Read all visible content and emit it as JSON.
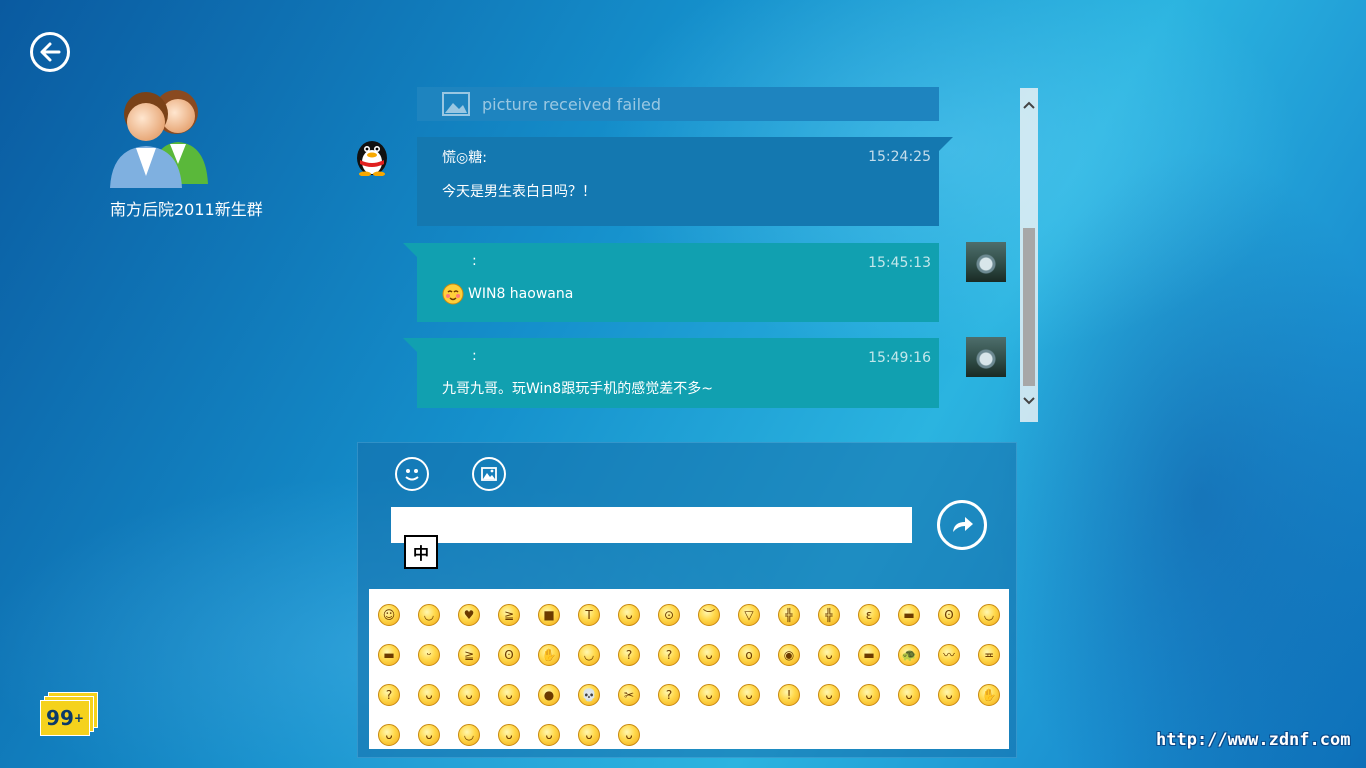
{
  "group": {
    "name": "南方后院2011新生群"
  },
  "messages": {
    "failed": {
      "text": "picture received failed"
    },
    "m1": {
      "sender": "慌◎糖:",
      "time": "15:24:25",
      "text": "今天是男生表白日吗？！"
    },
    "m2": {
      "sender": ":",
      "time": "15:45:13",
      "text": "WIN8 haowana",
      "emoji": "blush-emoji"
    },
    "m3": {
      "sender": ":",
      "time": "15:49:16",
      "text": "九哥九哥。玩Win8跟玩手机的感觉差不多~"
    }
  },
  "compose": {
    "input_value": "",
    "ime_label": "中",
    "tools": [
      "emoji-picker-icon",
      "image-picker-icon"
    ]
  },
  "emoji_rows": [
    [
      "☺",
      "◡",
      "♥",
      "≧",
      "■",
      "T",
      "ᴗ",
      "⊙",
      "︶",
      "▽",
      "╬",
      "╬",
      "ε",
      "▬",
      "ʘ",
      "◡"
    ],
    [
      "▬",
      "ᵕ",
      "≧",
      "ʘ",
      "✋",
      "◡",
      "?",
      "?",
      "ᴗ",
      "o",
      "◉",
      "ᴗ",
      "▬",
      "🐢",
      "〰",
      "≖"
    ],
    [
      "?",
      "ᴗ",
      "ᴗ",
      "ᴗ",
      "●",
      "💀",
      "✂",
      "?",
      "ᴗ",
      "ᴗ",
      "!",
      "ᴗ",
      "ᴗ",
      "ᴗ",
      "ᴗ",
      "✋"
    ],
    [
      "ᴗ",
      "ᴗ",
      "◡",
      "ᴗ",
      "ᴗ",
      "ᴗ",
      "ᴗ"
    ]
  ],
  "badge": {
    "count": "99",
    "suffix": "+"
  },
  "watermark": "http://www.zdnf.com",
  "colors": {
    "incoming_bubble": "#1478b0",
    "outgoing_bubble": "#11a0b0",
    "badge": "#f5d21c"
  }
}
